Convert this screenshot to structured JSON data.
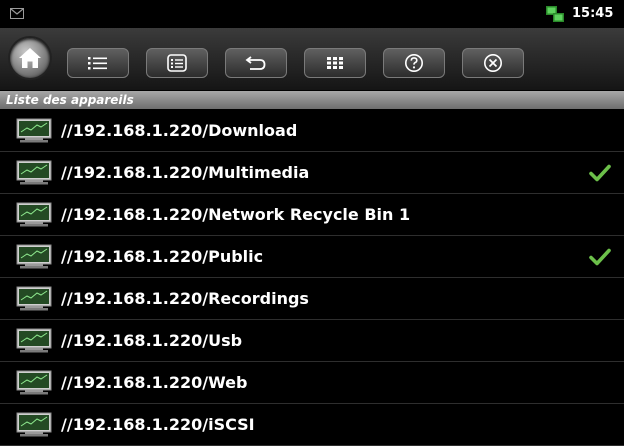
{
  "status_bar": {
    "time": "15:45",
    "icons": [
      "mail-icon",
      "network-icon"
    ]
  },
  "toolbar": {
    "buttons": [
      {
        "name": "home-button",
        "icon": "home-icon"
      },
      {
        "name": "list-view-button",
        "icon": "list-icon"
      },
      {
        "name": "details-view-button",
        "icon": "details-list-icon"
      },
      {
        "name": "back-button",
        "icon": "back-arrow-icon"
      },
      {
        "name": "grid-view-button",
        "icon": "grid-icon"
      },
      {
        "name": "help-button",
        "icon": "help-icon"
      },
      {
        "name": "close-button",
        "icon": "close-icon"
      }
    ]
  },
  "section": {
    "title": "Liste des appareils"
  },
  "devices": [
    {
      "path": "//192.168.1.220/Download",
      "checked": false
    },
    {
      "path": "//192.168.1.220/Multimedia",
      "checked": true
    },
    {
      "path": "//192.168.1.220/Network Recycle Bin 1",
      "checked": false
    },
    {
      "path": "//192.168.1.220/Public",
      "checked": true
    },
    {
      "path": "//192.168.1.220/Recordings",
      "checked": false
    },
    {
      "path": "//192.168.1.220/Usb",
      "checked": false
    },
    {
      "path": "//192.168.1.220/Web",
      "checked": false
    },
    {
      "path": "//192.168.1.220/iSCSI",
      "checked": false
    }
  ],
  "colors": {
    "check": "#6cc04a",
    "section_header": "#8a8a8a"
  }
}
